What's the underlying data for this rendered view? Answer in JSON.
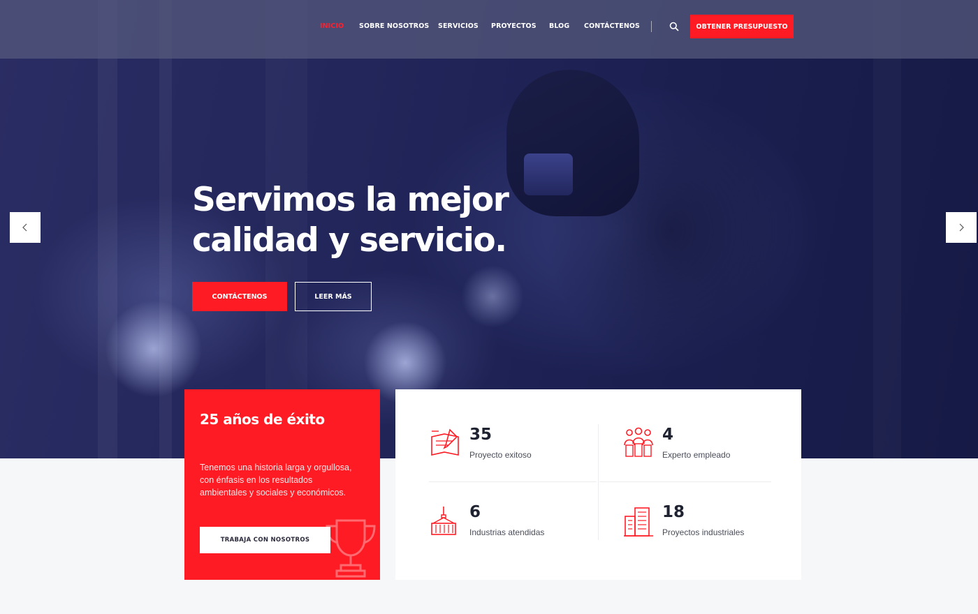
{
  "colors": {
    "accent": "#ff1b24",
    "hero_overlay": "#1c2052",
    "text_dark": "#1f2230",
    "page_bg": "#f6f7f9"
  },
  "nav": {
    "items": [
      {
        "label": "INICIO",
        "active": true
      },
      {
        "label": "SOBRE NOSOTROS",
        "active": false
      },
      {
        "label": "SERVICIOS",
        "active": false
      },
      {
        "label": "PROYECTOS",
        "active": false
      },
      {
        "label": "BLOG",
        "active": false
      },
      {
        "label": "CONTÁCTENOS",
        "active": false
      }
    ],
    "search_icon": "search-icon",
    "quote_button": "OBTENER PRESUPUESTO"
  },
  "hero": {
    "title_line1": "Servimos la mejor",
    "title_line2": "calidad y servicio.",
    "primary_button": "CONTÁCTENOS",
    "secondary_button": "LEER MÁS",
    "prev_icon": "chevron-left-icon",
    "next_icon": "chevron-right-icon"
  },
  "success_card": {
    "title": "25 años de éxito",
    "description": "Tenemos una historia larga y orgullosa, con énfasis en los resultados ambientales y sociales y económicos.",
    "button": "TRABAJA CON NOSOTROS",
    "icon": "trophy-icon"
  },
  "stats": [
    {
      "value": "35",
      "label": "Proyecto exitoso",
      "icon": "blueprint-icon"
    },
    {
      "value": "4",
      "label": "Experto empleado",
      "icon": "team-icon"
    },
    {
      "value": "6",
      "label": "Industrias atendidas",
      "icon": "crane-container-icon"
    },
    {
      "value": "18",
      "label": "Proyectos industriales",
      "icon": "buildings-icon"
    }
  ]
}
